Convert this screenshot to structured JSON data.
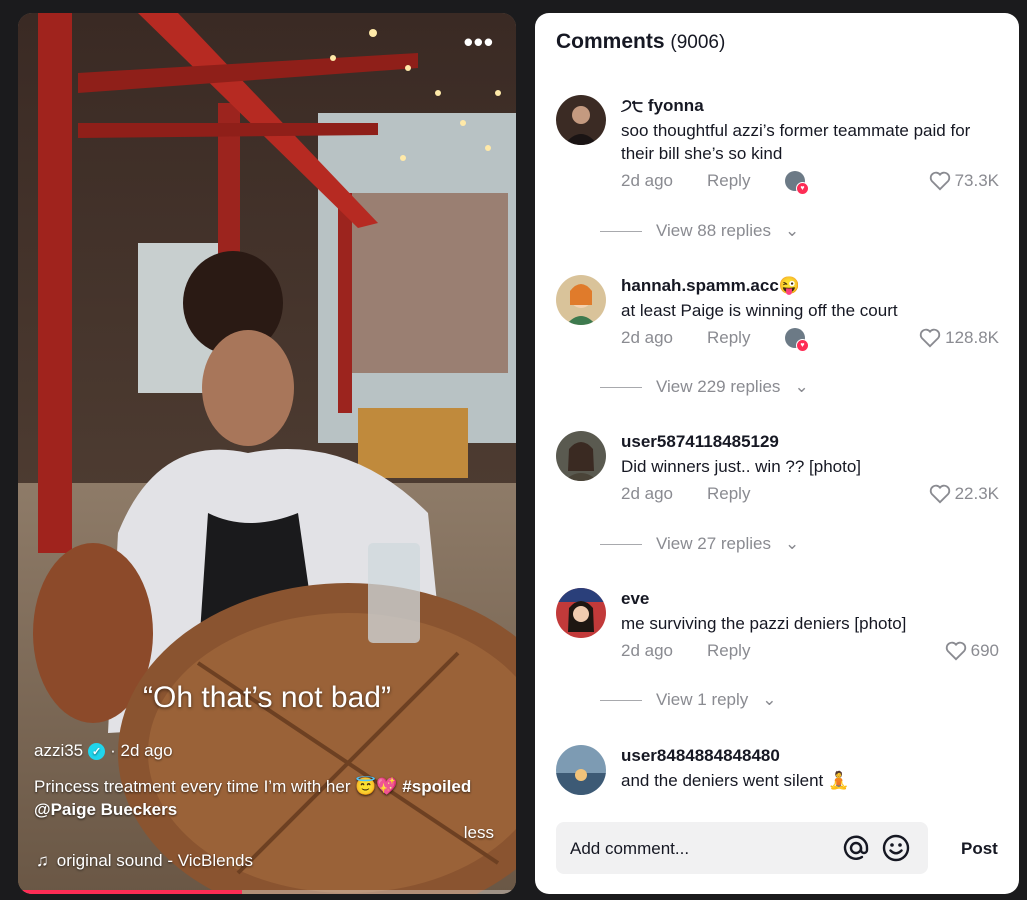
{
  "video": {
    "more_label": "•••",
    "overlay_caption": "“Oh that’s not bad”",
    "author": "azzi35",
    "posted": "· 2d ago",
    "description": "Princess treatment every time I’m with her 😇💖",
    "hashtag": "#spoiled",
    "mention": "@Paige Bueckers",
    "less_label": "less",
    "sound": "original sound - VicBlends",
    "progress": 0.45,
    "accent_color": "#fe2c55"
  },
  "comments_panel": {
    "title": "Comments",
    "count": "(9006)",
    "reply_label": "Reply",
    "items": [
      {
        "username": "੭੮ fyonna",
        "text": "soo thoughtful azzi’s former teammate paid for their bill she’s so kind",
        "time": "2d ago",
        "likes": "73.3K",
        "creator_liked": true,
        "replies": "View 88 replies"
      },
      {
        "username": "hannah.spamm.acc😜",
        "text": "at least Paige is winning off the court",
        "time": "2d ago",
        "likes": "128.8K",
        "creator_liked": true,
        "replies": "View 229 replies"
      },
      {
        "username": "user5874118485129",
        "text": "Did winners just.. win ?? [photo]",
        "time": "2d ago",
        "likes": "22.3K",
        "creator_liked": false,
        "replies": "View 27 replies"
      },
      {
        "username": "eve",
        "text": "me surviving the pazzi deniers [photo]",
        "time": "2d ago",
        "likes": "690",
        "creator_liked": false,
        "replies": "View 1 reply"
      },
      {
        "username": "user8484884848480",
        "text": "and the deniers went silent 🧘"
      }
    ],
    "input_placeholder": "Add comment...",
    "post_label": "Post"
  }
}
